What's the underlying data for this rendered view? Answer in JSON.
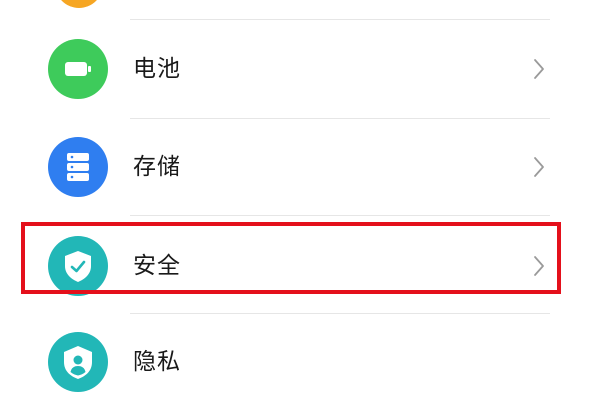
{
  "settings": {
    "items": [
      {
        "label": "电池",
        "icon": "battery-icon",
        "color": "#3ecb5b"
      },
      {
        "label": "存储",
        "icon": "storage-icon",
        "color": "#2f7ef0"
      },
      {
        "label": "安全",
        "icon": "shield-check-icon",
        "color": "#22b7b7"
      },
      {
        "label": "隐私",
        "icon": "privacy-icon",
        "color": "#22b7b7"
      }
    ],
    "top_partial_icon_color": "#f6a623",
    "highlight_color": "#e4101b",
    "highlighted_item": "安全"
  }
}
